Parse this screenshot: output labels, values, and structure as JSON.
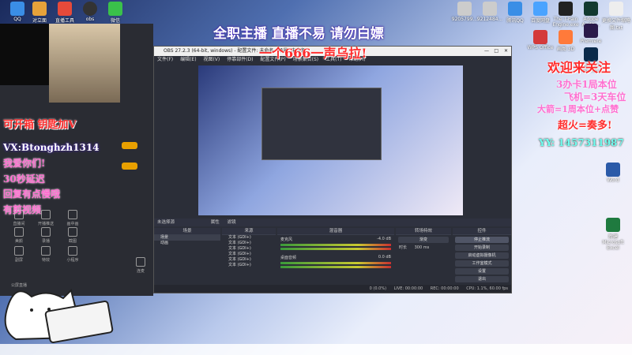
{
  "desktop_icons_left": [
    {
      "label": "QQ"
    },
    {
      "label": "对立面"
    },
    {
      "label": "直播工具"
    },
    {
      "label": "obs"
    },
    {
      "label": "微信"
    }
  ],
  "desktop_icons_right": [
    {
      "label": "9205799..."
    },
    {
      "label": "9212484..."
    },
    {
      "label": "腾讯QQ"
    },
    {
      "label": "百度网盘"
    },
    {
      "label": "The T-Pain Engine.exe"
    },
    {
      "label": "Adobe Auditi..."
    },
    {
      "label": "Premiere"
    },
    {
      "label": "更换文件缩略图.txt"
    },
    {
      "label": "WPS Office"
    },
    {
      "label": "画图 3D"
    },
    {
      "label": "Adobe Photosh..."
    },
    {
      "label": "Word"
    },
    {
      "label": "新建 Microsoft Excel"
    }
  ],
  "overlay": {
    "top_line1": "全职主播 直播不易 请勿白嫖",
    "top_line2": "一个666一声乌拉!",
    "left_line1": "可开箱 钥匙加V",
    "left_line2": "VX:Btonghzh1314",
    "left_line3": "我爱你们!",
    "left_line4": "30秒延迟",
    "left_line5": "回复有点慢哦",
    "left_line6": "有剪视频",
    "right_line1": "欢迎来关注",
    "right_line2": "3办卡1局本位",
    "right_line3": "飞机=3天车位",
    "right_line4": "大箭=1周本位+点赞",
    "right_line5": "超火=奏多!",
    "right_line6": "YY: 1457311987"
  },
  "obs": {
    "title": "OBS 27.2.3 (64-bit, windows) - 配置文件: 未命名 - 场景: 未命名",
    "menu": [
      "文件(F)",
      "编辑(E)",
      "视图(V)",
      "停靠部件(D)",
      "配置文件(P)",
      "场景集合(S)",
      "工具(T)",
      "帮助(H)"
    ],
    "scene_label": "未选择源",
    "properties_label": "属性",
    "filters_label": "滤镜",
    "panels": {
      "scenes": "场景",
      "sources": "来源",
      "mixer": "混音器",
      "transitions": "转场特效",
      "controls": "控件"
    },
    "scenes": [
      "场景",
      "动画"
    ],
    "sources": [
      "文本 (GDI+)",
      "文本 (GDI+)",
      "文本 (GDI+)",
      "文本 (GDI+)",
      "文本 (GDI+)",
      "文本 (GDI+)"
    ],
    "mixer": [
      {
        "name": "麦克风",
        "db": "-4.0 dB"
      },
      {
        "name": "桌面音频",
        "db": "0.0 dB"
      }
    ],
    "transition_value": "渐变",
    "duration_label": "时长",
    "duration_value": "300 ms",
    "controls": [
      "停止推流",
      "开始录制",
      "启动虚拟摄像机",
      "工作室模式",
      "设置",
      "退出"
    ],
    "status": {
      "live": "LIVE: 00:00:00",
      "rec": "REC: 00:00:00",
      "cpu": "CPU: 1.1%, 60.00 fps",
      "dropped": "0 (0.0%)"
    }
  },
  "side_app": {
    "items": [
      {
        "label": "直播间"
      },
      {
        "label": "开播推送"
      },
      {
        "label": "画中画"
      },
      {
        "label": "美颜"
      },
      {
        "label": "录播"
      },
      {
        "label": "截图"
      },
      {
        "label": "副屏"
      },
      {
        "label": "特效"
      },
      {
        "label": "小程序"
      },
      {
        "label": "连麦"
      }
    ],
    "bottom_label": "公屏直播"
  },
  "colors": {
    "obs_bg": "#2b2e38",
    "overlay_red": "#ff2b2b",
    "overlay_pink": "#ff6fd0"
  }
}
